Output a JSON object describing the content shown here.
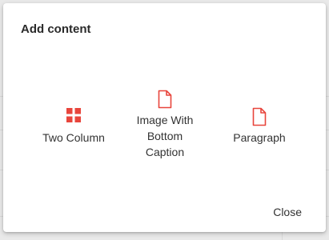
{
  "dialog": {
    "title": "Add content",
    "close_label": "Close"
  },
  "options": [
    {
      "label": "Two Column",
      "icon": "grid-icon"
    },
    {
      "label": "Image With Bottom Caption",
      "icon": "document-icon"
    },
    {
      "label": "Paragraph",
      "icon": "document-icon"
    }
  ],
  "colors": {
    "accent": "#e8453c",
    "text": "#333333"
  }
}
